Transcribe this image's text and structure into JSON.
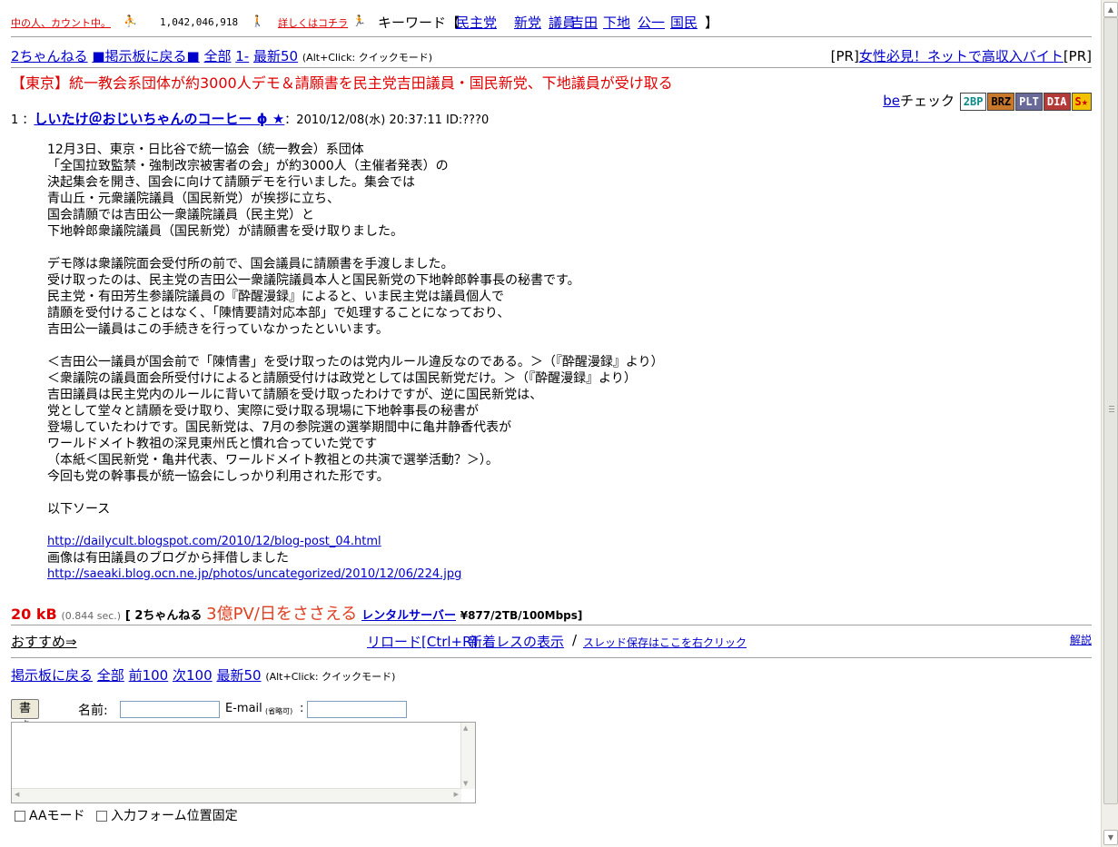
{
  "top_banner": {
    "counter_link": "中の人、カウント中。",
    "counter_value": "1,042,046,918",
    "details_link": "詳しくはコチラ",
    "keyword_label": "キーワード【",
    "keywords": [
      "民主党",
      "新党",
      "議員",
      "吉田",
      "下地",
      "公一",
      "国民"
    ],
    "keyword_close": "】"
  },
  "nav_top": {
    "site": "2ちゃんねる",
    "back_board": "■掲示板に戻る■",
    "all": "全部",
    "first": "1-",
    "latest50": "最新50",
    "hint": "(Alt+Click: クイックモード)",
    "pr_left": "[PR]",
    "pr_link": "女性必見！ネットで高収入バイト",
    "pr_right": "[PR]"
  },
  "thread_title": "【東京】統一教会系団体が約3000人デモ＆請願書を民主党吉田議員・国民新党、下地議員が受け取る",
  "be": {
    "be_link": "be",
    "check_label": "チェック",
    "badges": [
      {
        "label": "2BP",
        "bg": "#ffffff",
        "fg": "#0a8a8a"
      },
      {
        "label": "BRZ",
        "bg": "#c8782a",
        "fg": "#000000"
      },
      {
        "label": "PLT",
        "bg": "#6a6a9a",
        "fg": "#ffffff"
      },
      {
        "label": "DIA",
        "bg": "#b43a3a",
        "fg": "#ffffff"
      },
      {
        "label": "S★",
        "bg": "#f2c200",
        "fg": "#cc0000"
      }
    ]
  },
  "post": {
    "number": "1",
    "sep": "：",
    "name": "しいたけ＠おじいちゃんのコーヒー",
    "name_tail": " ϕ ★",
    "meta": "：2010/12/08(水) 20:37:11 ID:???0",
    "lines": [
      "12月3日、東京・日比谷で統一協会（統一教会）系団体",
      "「全国拉致監禁・強制改宗被害者の会」が約3000人（主催者発表）の",
      "決起集会を開き、国会に向けて請願デモを行いました。集会では",
      "青山丘・元衆議院議員（国民新党）が挨拶に立ち、",
      "国会請願では吉田公一衆議院議員（民主党）と",
      "下地幹郎衆議院議員（国民新党）が請願書を受け取りました。",
      "",
      "デモ隊は衆議院面会受付所の前で、国会議員に請願書を手渡しました。",
      "受け取ったのは、民主党の吉田公一衆議院議員本人と国民新党の下地幹郎幹事長の秘書です。",
      "民主党・有田芳生参議院議員の『酔醒漫録』によると、いま民主党は議員個人で",
      "請願を受付けることはなく、「陳情要請対応本部」で処理することになっており、",
      "吉田公一議員はこの手続きを行っていなかったといいます。",
      "",
      "＜吉田公一議員が国会前で「陳情書」を受け取ったのは党内ルール違反なのである。＞（『酔醒漫録』より）",
      "＜衆議院の議員面会所受付けによると請願受付けは政党としては国民新党だけ。＞（『酔醒漫録』より）",
      "吉田議員は民主党内のルールに背いて請願を受け取ったわけですが、逆に国民新党は、",
      "党として堂々と請願を受け取り、実際に受け取る現場に下地幹事長の秘書が",
      "登場していたわけです。国民新党は、7月の参院選の選挙期間中に亀井静香代表が",
      "ワールドメイト教祖の深見東州氏と慣れ合っていた党です",
      "（本紙＜国民新党・亀井代表、ワールドメイト教祖との共演で選挙活動？＞）。",
      "今回も党の幹事長が統一協会にしっかり利用された形です。",
      "",
      "以下ソース",
      ""
    ],
    "url1": "http://dailycult.blogspot.com/2010/12/blog-post_04.html",
    "image_note": "画像は有田議員のブログから拝借しました",
    "url2": "http://saeaki.blog.ocn.ne.jp/photos/uncategorized/2010/12/06/224.jpg"
  },
  "footer": {
    "size": "20 kB",
    "time": "(0.844 sec.)",
    "brand_open": "[ 2ちゃんねる",
    "pv": "3億PV/日をささえる",
    "rental": "レンタルサーバー",
    "spec": "¥877/2TB/100Mbps]"
  },
  "menu": {
    "recommend": "おすすめ⇒",
    "reload": "リロード[Ctrl+R]",
    "new_res": "新着レスの表示",
    "slash": "/",
    "save": "スレッド保存はここを右クリック",
    "explain": "解説"
  },
  "nav_bottom": {
    "back_board": "掲示板に戻る",
    "all": "全部",
    "prev100": "前100",
    "next100": "次100",
    "latest50": "最新50",
    "hint": "(Alt+Click: クイックモード)"
  },
  "form": {
    "submit": "書き込む",
    "name_label": "名前:",
    "email_label": "E-mail",
    "email_note": "(省略可)",
    "email_colon": ":",
    "aa_mode": "AAモード",
    "fix_position": "入力フォーム位置固定"
  }
}
